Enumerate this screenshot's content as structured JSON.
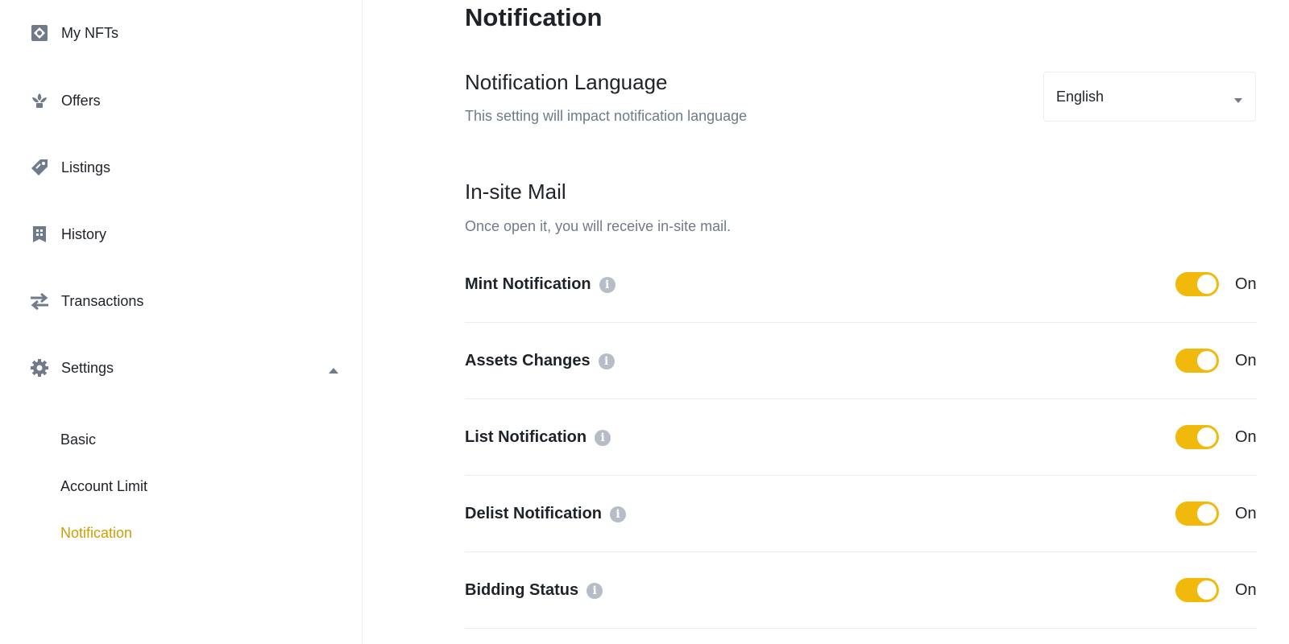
{
  "sidebar": {
    "items": [
      {
        "label": "My NFTs",
        "icon": "nft-icon"
      },
      {
        "label": "Offers",
        "icon": "offers-icon"
      },
      {
        "label": "Listings",
        "icon": "tag-icon"
      },
      {
        "label": "History",
        "icon": "history-icon"
      },
      {
        "label": "Transactions",
        "icon": "transfer-icon"
      },
      {
        "label": "Settings",
        "icon": "gear-icon"
      }
    ],
    "settings_sub": [
      {
        "label": "Basic"
      },
      {
        "label": "Account Limit"
      },
      {
        "label": "Notification",
        "active": true
      }
    ]
  },
  "main": {
    "title": "Notification",
    "language": {
      "title": "Notification Language",
      "description": "This setting will impact notification language",
      "selected": "English"
    },
    "insite": {
      "title": "In-site Mail",
      "description": "Once open it, you will receive in-site mail.",
      "rows": [
        {
          "label": "Mint Notification",
          "state": "On",
          "enabled": true
        },
        {
          "label": "Assets Changes",
          "state": "On",
          "enabled": true
        },
        {
          "label": "List Notification",
          "state": "On",
          "enabled": true
        },
        {
          "label": "Delist Notification",
          "state": "On",
          "enabled": true
        },
        {
          "label": "Bidding Status",
          "state": "On",
          "enabled": true
        }
      ]
    }
  },
  "colors": {
    "accent": "#f0b90b",
    "active_text": "#d09d04",
    "muted_text": "#707a8a",
    "icon_gray": "#707a8a",
    "divider": "#eaecef"
  }
}
